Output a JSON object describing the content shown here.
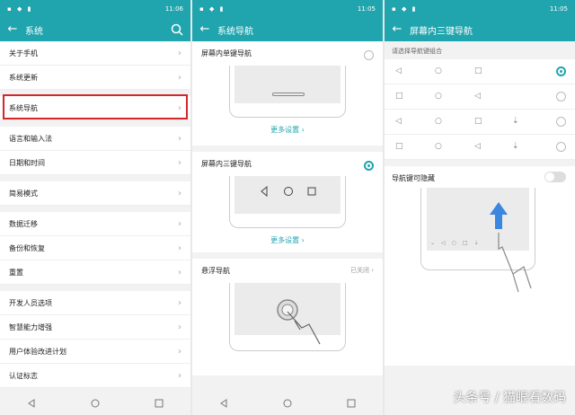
{
  "colors": {
    "accent": "#20a4ae",
    "highlight": "#d5262a"
  },
  "statusbar": {
    "time1": "11:06",
    "time2": "11:05",
    "time3": "11:05"
  },
  "screen1": {
    "title": "系统",
    "items": [
      "关于手机",
      "系统更新",
      "系统导航",
      "语言和输入法",
      "日期和时间",
      "简易模式",
      "数据迁移",
      "备份和恢复",
      "重置",
      "开发人员选项",
      "智慧能力增强",
      "用户体验改进计划",
      "认证标志"
    ]
  },
  "screen2": {
    "title": "系统导航",
    "single_nav": "屏幕内单键导航",
    "three_nav": "屏幕内三键导航",
    "float_nav": "悬浮导航",
    "more1": "更多设置 ›",
    "more2": "更多设置 ›",
    "float_status": "已关闭 ›"
  },
  "screen3": {
    "title": "屏幕内三键导航",
    "combo_header": "请选择导航键组合",
    "hide_label": "导航键可隐藏"
  },
  "watermark": "头条号 / 猫眼看数码"
}
